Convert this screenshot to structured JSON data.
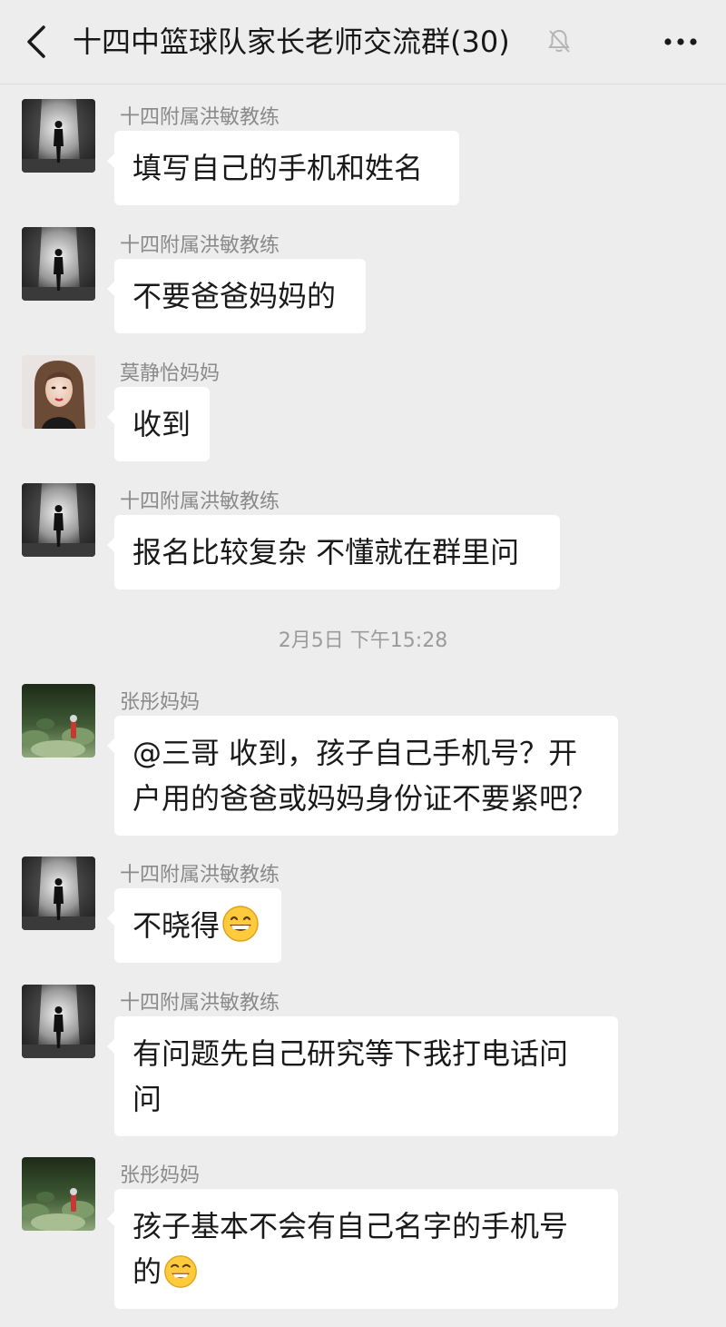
{
  "header": {
    "title": "十四中篮球队家长老师交流群(30)",
    "mute_icon": "bell-muted-icon",
    "back_icon": "chevron-left-icon",
    "more_icon": "more-dots-icon"
  },
  "timestamp": "2月5日 下午15:28",
  "messages": [
    {
      "sender": "十四附属洪敏教练",
      "text": "填写自己的手机和姓名",
      "avatar": "coach-avatar"
    },
    {
      "sender": "十四附属洪敏教练",
      "text": "不要爸爸妈妈的",
      "avatar": "coach-avatar"
    },
    {
      "sender": "莫静怡妈妈",
      "text": "收到",
      "avatar": "woman-avatar"
    },
    {
      "sender": "十四附属洪敏教练",
      "text": "报名比较复杂 不懂就在群里问",
      "avatar": "coach-avatar"
    },
    {
      "sender": "张彤妈妈",
      "line1": "@三哥  收到，孩子自己手机号？开",
      "line2": "户用的爸爸或妈妈身份证不要紧吧？",
      "avatar": "garden-avatar"
    },
    {
      "sender": "十四附属洪敏教练",
      "text": "不晓得",
      "emoji": "grinning-emoji",
      "avatar": "coach-avatar"
    },
    {
      "sender": "十四附属洪敏教练",
      "line1": "有问题先自己研究等下我打电话问",
      "line2": "问",
      "avatar": "coach-avatar"
    },
    {
      "sender": "张彤妈妈",
      "line1": "孩子基本不会有自己名字的手机号",
      "line2": "的",
      "emoji": "smirk-emoji",
      "avatar": "garden-avatar"
    }
  ]
}
